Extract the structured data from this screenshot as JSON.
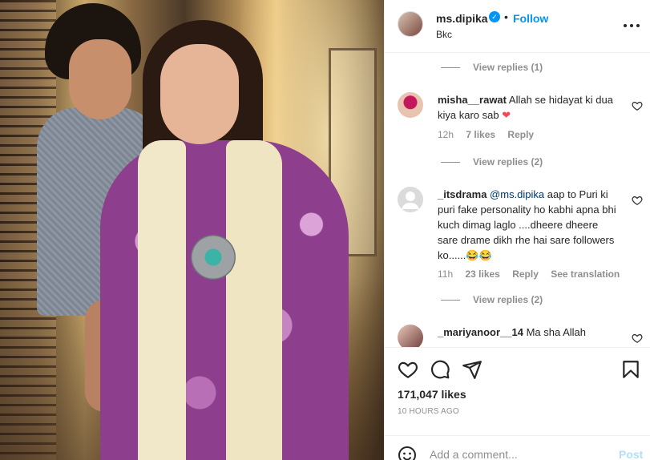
{
  "post": {
    "username": "ms.dipika",
    "follow_label": "Follow",
    "separator": "•",
    "location": "Bkc",
    "verified_glyph": "✓"
  },
  "comments": [
    {
      "type": "view_replies",
      "label": "View replies (1)"
    },
    {
      "type": "comment",
      "username": "misha__rawat",
      "text": "Allah se hidayat ki dua kiya karo sab",
      "emoji": "❤",
      "time": "12h",
      "likes": "7 likes",
      "reply": "Reply"
    },
    {
      "type": "view_replies",
      "label": "View replies (2)"
    },
    {
      "type": "comment",
      "username": "_itsdrama",
      "mention": "@ms.dipika",
      "text": "aap to Puri ki puri fake personality ho kabhi apna bhi kuch dimag laglo ....dheere dheere sare drame dikh rhe hai sare followers ko......😂😂",
      "time": "11h",
      "likes": "23 likes",
      "reply": "Reply",
      "translate": "See translation"
    },
    {
      "type": "view_replies",
      "label": "View replies (2)"
    },
    {
      "type": "comment",
      "username": "_mariyanoor__14",
      "text": "Ma sha Allah"
    }
  ],
  "likes_count": "171,047 likes",
  "time_ago": "10 HOURS AGO",
  "add_comment": {
    "placeholder": "Add a comment...",
    "post_label": "Post"
  },
  "icons": [
    "heart-icon",
    "comment-icon",
    "share-icon",
    "bookmark-icon",
    "emoji-icon",
    "more-options-icon",
    "verified-badge-icon"
  ],
  "colors": {
    "link_blue": "#0095f6",
    "mention_blue": "#00376b",
    "muted": "#8e8e8e",
    "heart_red": "#ed4956",
    "post_disabled": "#b2dffc"
  }
}
